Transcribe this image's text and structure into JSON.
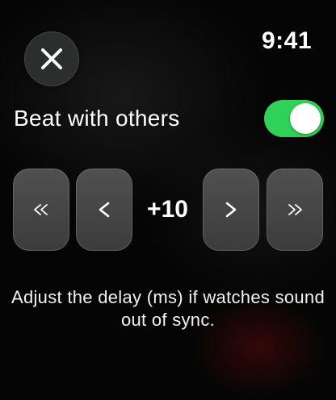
{
  "status": {
    "time": "9:41"
  },
  "header": {
    "close_icon": "close-icon"
  },
  "settings": {
    "beat_with_others": {
      "label": "Beat with others",
      "enabled": true,
      "accent": "#30d158"
    }
  },
  "delay_stepper": {
    "value": "+10",
    "buttons": [
      {
        "id": "fast-back",
        "icon": "double-chevron-left-icon"
      },
      {
        "id": "back",
        "icon": "chevron-left-icon"
      },
      {
        "id": "forward",
        "icon": "chevron-right-icon"
      },
      {
        "id": "fast-forward",
        "icon": "double-chevron-right-icon"
      }
    ]
  },
  "help": {
    "text": "Adjust the delay (ms) if watches sound out of sync."
  }
}
